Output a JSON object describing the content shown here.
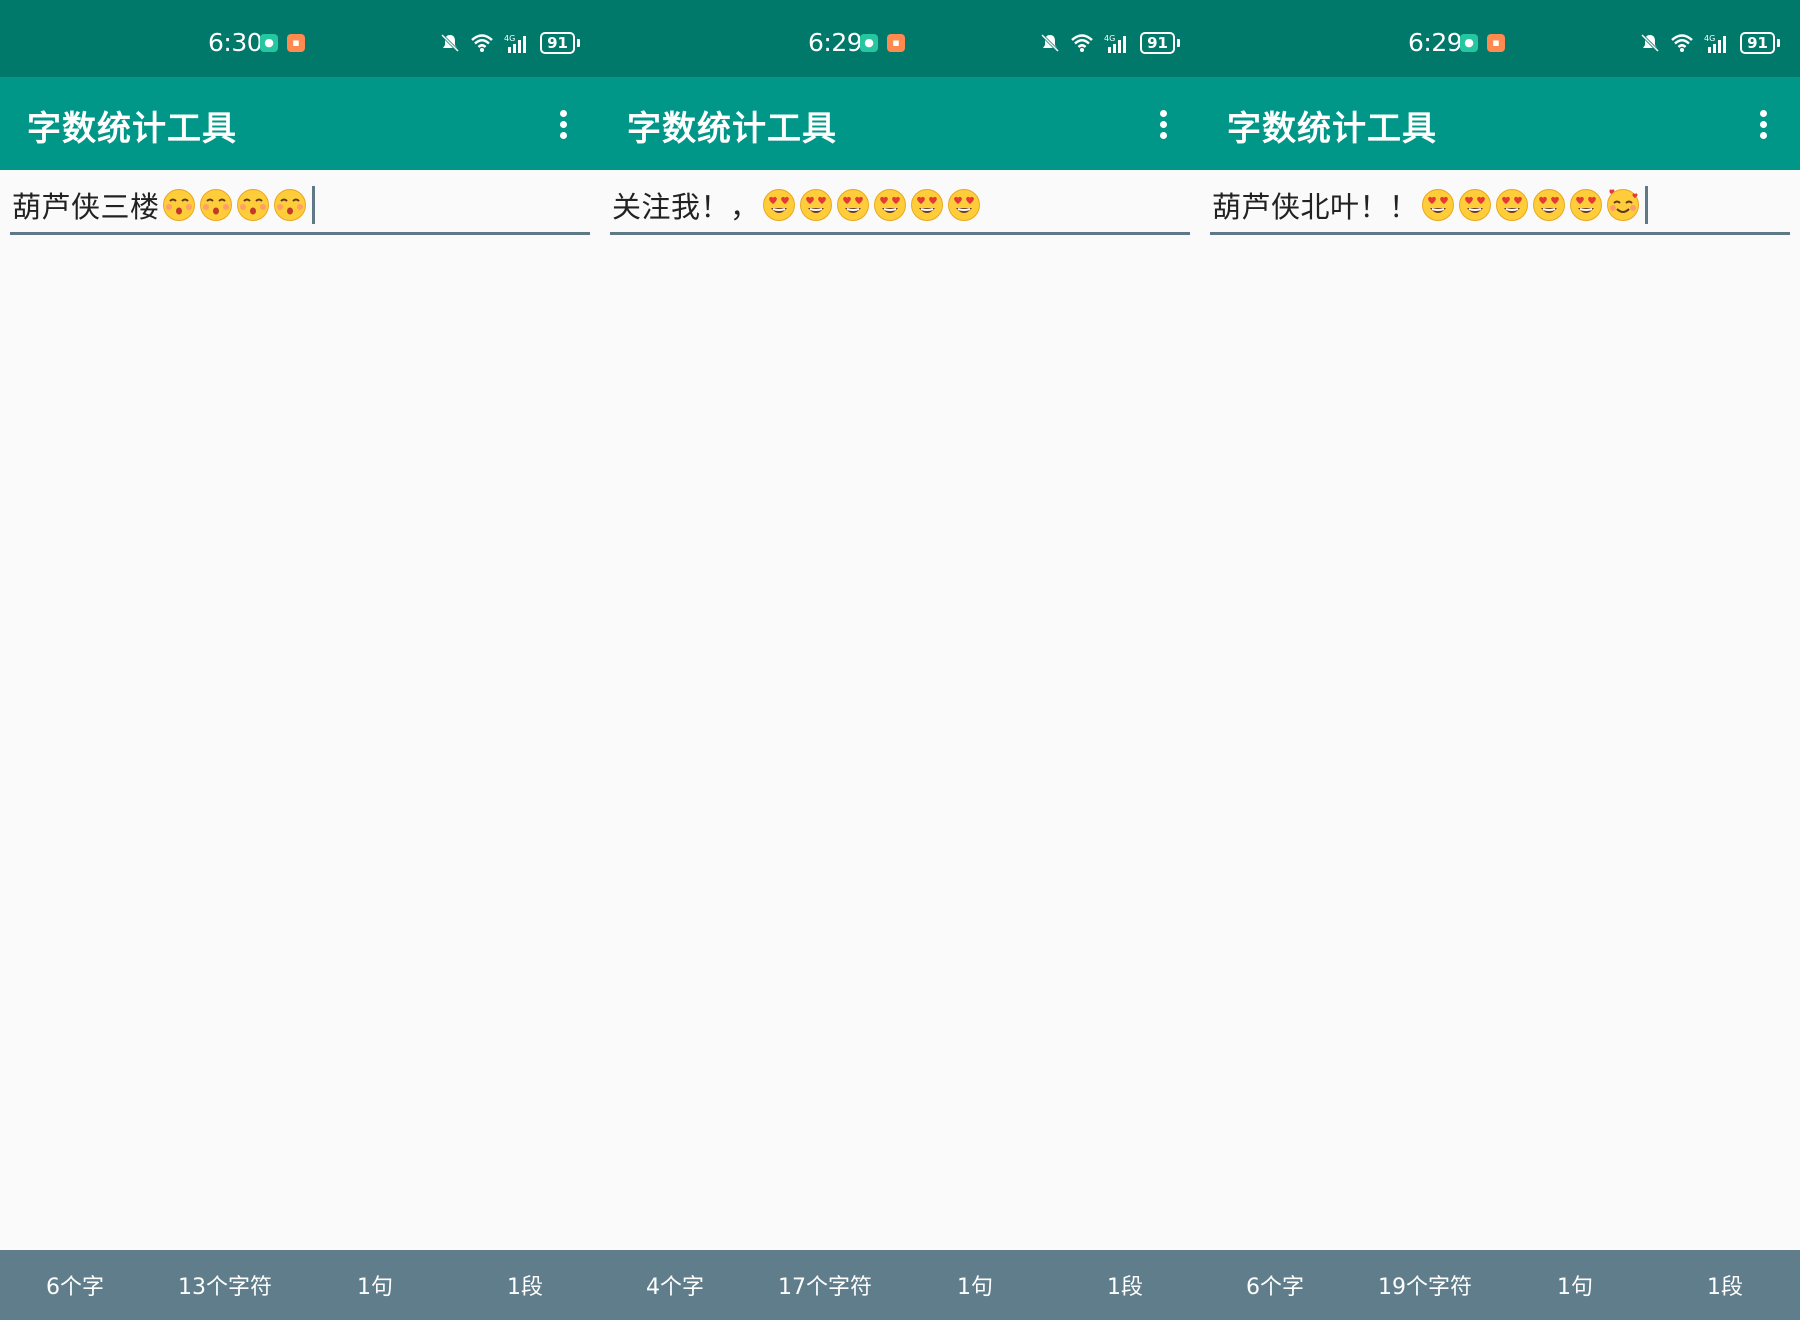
{
  "colors": {
    "status_bar": "#00796b",
    "app_bar": "#009688",
    "bottom_bar": "#607d8b",
    "underline": "#5f7a87",
    "background": "#fafafa"
  },
  "screens": [
    {
      "status": {
        "time": "6:30",
        "battery": "91"
      },
      "app_title": "字数统计工具",
      "input": {
        "text": "葫芦侠三楼",
        "emojis": [
          "kissing-face",
          "kissing-face",
          "kissing-face",
          "kissing-face"
        ]
      },
      "stats": {
        "chars": "6个字",
        "symbols": "13个字符",
        "sentences": "1句",
        "paragraphs": "1段"
      }
    },
    {
      "status": {
        "time": "6:29",
        "battery": "91"
      },
      "app_title": "字数统计工具",
      "input": {
        "text": "关注我！，",
        "emojis": [
          "heart-eyes",
          "heart-eyes",
          "heart-eyes",
          "heart-eyes",
          "heart-eyes",
          "heart-eyes"
        ]
      },
      "stats": {
        "chars": "4个字",
        "symbols": "17个字符",
        "sentences": "1句",
        "paragraphs": "1段"
      }
    },
    {
      "status": {
        "time": "6:29",
        "battery": "91"
      },
      "app_title": "字数统计工具",
      "input": {
        "text": "葫芦侠北叶！！",
        "emojis": [
          "heart-eyes",
          "heart-eyes",
          "heart-eyes",
          "heart-eyes",
          "heart-eyes",
          "smiling-hearts"
        ]
      },
      "stats": {
        "chars": "6个字",
        "symbols": "19个字符",
        "sentences": "1句",
        "paragraphs": "1段"
      }
    }
  ]
}
